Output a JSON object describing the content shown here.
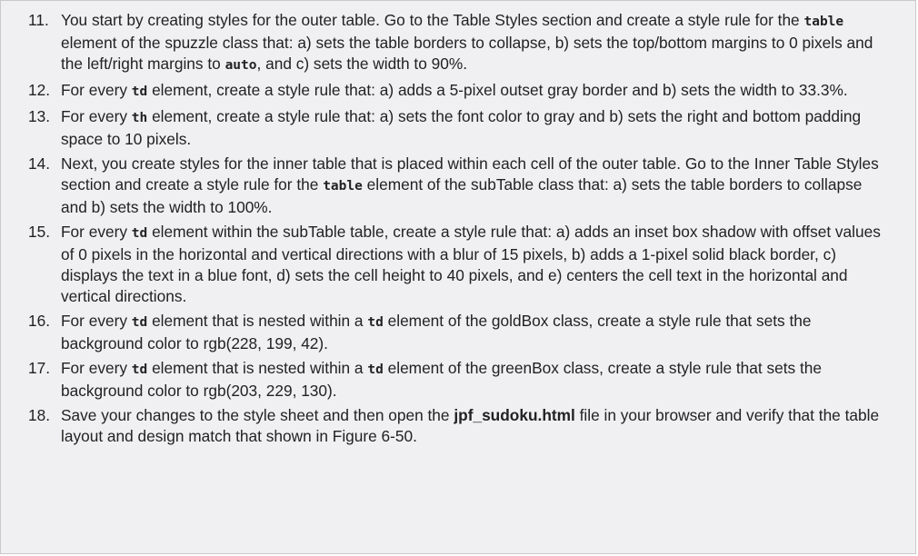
{
  "steps": [
    {
      "number": "11.",
      "parts": [
        {
          "text": "You start by creating styles for the outer table. Go to the Table Styles section and create a style rule for the "
        },
        {
          "code": "table"
        },
        {
          "text": " element of the spuzzle class that: a) sets the table borders to collapse, b) sets the top/bottom margins to 0 pixels and the left/right margins to "
        },
        {
          "code": "auto"
        },
        {
          "text": ", and c) sets the width to 90%."
        }
      ]
    },
    {
      "number": "12.",
      "parts": [
        {
          "text": "For every "
        },
        {
          "code": "td"
        },
        {
          "text": " element, create a style rule that: a) adds a 5-pixel outset gray border and b) sets the width to 33.3%."
        }
      ]
    },
    {
      "number": "13.",
      "parts": [
        {
          "text": "For every "
        },
        {
          "code": "th"
        },
        {
          "text": " element, create a style rule that: a) sets the font color to gray and b) sets the right and bottom padding space to 10 pixels."
        }
      ]
    },
    {
      "number": "14.",
      "parts": [
        {
          "text": "Next, you create styles for the inner table that is placed within each cell of the outer table. Go to the Inner Table Styles section and create a style rule for the "
        },
        {
          "code": "table"
        },
        {
          "text": " element of the subTable class that: a) sets the table borders to collapse and b) sets the width to 100%."
        }
      ]
    },
    {
      "number": "15.",
      "parts": [
        {
          "text": "For every "
        },
        {
          "code": "td"
        },
        {
          "text": " element within the subTable table, create a style rule that: a) adds an inset box shadow with offset values of 0 pixels in the horizontal and vertical directions with a blur of 15 pixels, b) adds a 1-pixel solid black border, c) displays the text in a blue font, d) sets the cell height to 40 pixels, and e) centers the cell text in the horizontal and vertical directions."
        }
      ]
    },
    {
      "number": "16.",
      "parts": [
        {
          "text": "For every "
        },
        {
          "code": "td"
        },
        {
          "text": " element that is nested within a "
        },
        {
          "code": "td"
        },
        {
          "text": " element of the goldBox class, create a style rule that sets the background color to rgb(228, 199, 42)."
        }
      ]
    },
    {
      "number": "17.",
      "parts": [
        {
          "text": "For every "
        },
        {
          "code": "td"
        },
        {
          "text": " element that is nested within a "
        },
        {
          "code": "td"
        },
        {
          "text": " element of the greenBox class, create a style rule that sets the background color to rgb(203, 229, 130)."
        }
      ]
    },
    {
      "number": "18.",
      "parts": [
        {
          "text": "Save your changes to the style sheet and then open the "
        },
        {
          "file": "jpf_sudoku.html"
        },
        {
          "text": " file in your browser and verify that the table layout and design match that shown in Figure 6-50."
        }
      ]
    }
  ],
  "colors": {
    "background": "#f0eff2",
    "border": "#c9c9c9",
    "text": "#222222"
  }
}
